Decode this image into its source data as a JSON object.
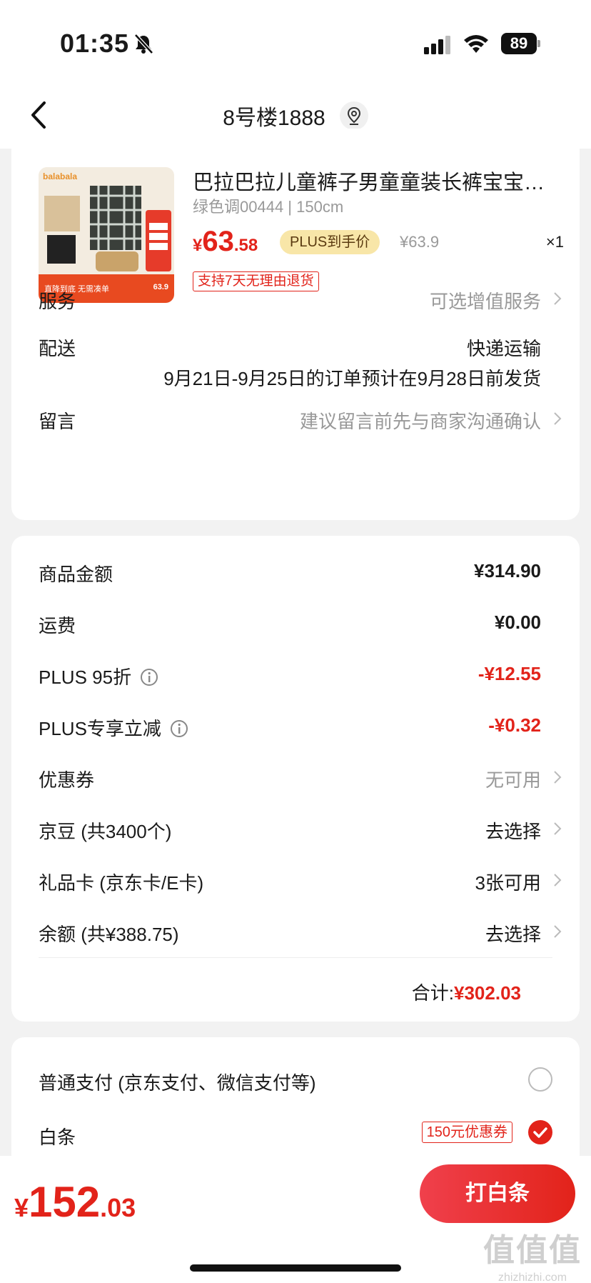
{
  "status_bar": {
    "time": "01:35",
    "battery": "89"
  },
  "nav": {
    "address": "8号楼1888"
  },
  "product": {
    "image_brand": "balabala",
    "image_promo": "直降到底 无需凑单",
    "image_price": "63.9",
    "name": "巴拉巴拉儿童裤子男童童装长裤宝宝秋冬...",
    "spec": "绿色调00444 | 150cm",
    "price_symbol": "¥",
    "price_int": "63",
    "price_dec": ".58",
    "plus_tag": "PLUS到手价",
    "original_price": "¥63.9",
    "quantity": "×1",
    "return_tag": "支持7天无理由退货"
  },
  "service": {
    "label": "服务",
    "value": "可选增值服务"
  },
  "delivery": {
    "label": "配送",
    "value": "快递运输",
    "note": "9月21日-9月25日的订单预计在9月28日前发货"
  },
  "message": {
    "label": "留言",
    "placeholder": "建议留言前先与商家沟通确认"
  },
  "summary": {
    "goods_label": "商品金额",
    "goods_value": "¥314.90",
    "shipping_label": "运费",
    "shipping_value": "¥0.00",
    "plus95_label": "PLUS 95折",
    "plus95_value": "-¥12.55",
    "plus_reduce_label": "PLUS专享立减",
    "plus_reduce_value": "-¥0.32",
    "coupon_label": "优惠券",
    "coupon_value": "无可用",
    "jd_bean_label": "京豆 (共3400个)",
    "jd_bean_value": "去选择",
    "gift_card_label": "礼品卡 (京东卡/E卡)",
    "gift_card_value": "3张可用",
    "balance_label": "余额 (共¥388.75)",
    "balance_value": "去选择",
    "total_label": "合计:",
    "total_value": "¥302.03"
  },
  "payment": {
    "normal_label": "普通支付 (京东支付、微信支付等)",
    "baitiao_label": "白条",
    "baitiao_coupon": "150元优惠券",
    "selected": "baitiao"
  },
  "bottom": {
    "pay_symbol": "¥",
    "pay_int": "152",
    "pay_dec": ".03",
    "pay_button": "打白条"
  },
  "watermark": {
    "big": "值值值",
    "small": "zhizhizhi.com"
  },
  "colors": {
    "accent": "#e2231a",
    "plus_gold": "#f8e6a8"
  }
}
